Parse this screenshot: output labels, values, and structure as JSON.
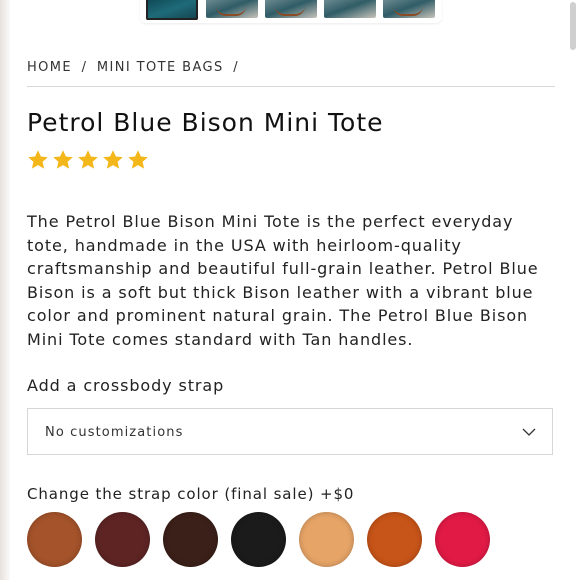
{
  "breadcrumb": {
    "home": "HOME",
    "sep1": "/",
    "category": "MINI TOTE BAGS",
    "sep2": "/"
  },
  "product": {
    "title": "Petrol Blue Bison Mini Tote",
    "rating_stars": 5,
    "rating_color": "#f4b71a",
    "description": "The Petrol Blue Bison Mini Tote is the perfect everyday tote, handmade in the USA with heirloom-quality craftsmanship and beautiful full-grain leather. Petrol Blue Bison is a soft but thick Bison leather with a vibrant blue color and prominent natural grain. The Petrol Blue Bison Mini Tote comes standard with Tan handles."
  },
  "crossbody": {
    "label": "Add a crossbody strap",
    "selected": "No customizations",
    "icon": "chevron-down-icon"
  },
  "strap_color": {
    "label": "Change the strap color (final sale) +$0",
    "swatches": [
      {
        "color": "#a4532a"
      },
      {
        "color": "#5e2424"
      },
      {
        "color": "#3b2019"
      },
      {
        "color": "#1b1b1c"
      },
      {
        "color": "#e6a467"
      },
      {
        "color": "#c75418"
      },
      {
        "color": "#e11a45"
      }
    ]
  },
  "thumbnails": {
    "count": 5,
    "selected_index": 0
  }
}
